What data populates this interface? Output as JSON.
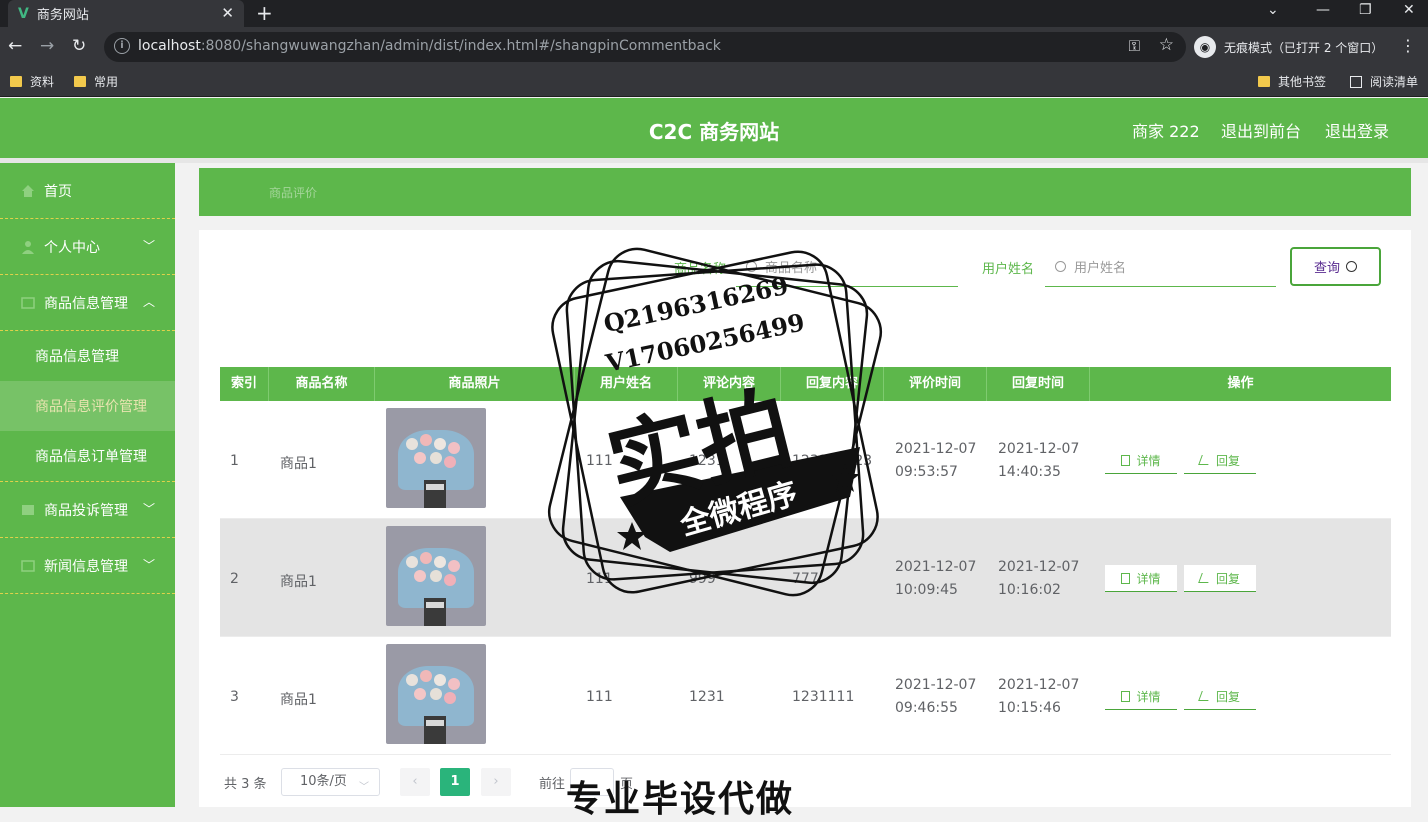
{
  "browser": {
    "tab_title": "商务网站",
    "url_host": "localhost",
    "url_rest": ":8080/shangwuwangzhan/admin/dist/index.html#/shangpinCommentback",
    "incognito_label": "无痕模式（已打开 2 个窗口）",
    "bookmarks": [
      "资料",
      "常用"
    ],
    "bookmarks_right": [
      "其他书签",
      "阅读清单"
    ]
  },
  "header": {
    "title": "C2C 商务网站",
    "user": "商家 222",
    "to_front": "退出到前台",
    "logout": "退出登录"
  },
  "sidebar": {
    "items": [
      {
        "label": "首页",
        "icon": "home-icon"
      },
      {
        "label": "个人中心",
        "icon": "user-icon",
        "chevron": "down"
      },
      {
        "label": "商品信息管理",
        "icon": "box-icon",
        "chevron": "up"
      },
      {
        "label": "商品投诉管理",
        "icon": "box-icon",
        "chevron": "down"
      },
      {
        "label": "新闻信息管理",
        "icon": "box-icon",
        "chevron": "down"
      }
    ],
    "sub_items": [
      "商品信息管理",
      "商品信息评价管理",
      "商品信息订单管理"
    ],
    "active_sub": 1
  },
  "breadcrumb": "商品评价",
  "search": {
    "product_label": "商品名称",
    "product_placeholder": "商品名称",
    "user_label": "用户姓名",
    "user_placeholder": "用户姓名",
    "query_button": "查询"
  },
  "table": {
    "headers": [
      "索引",
      "商品名称",
      "商品照片",
      "用户姓名",
      "评论内容",
      "回复内容",
      "评价时间",
      "回复时间",
      "操作"
    ],
    "rows": [
      {
        "index": "1",
        "name": "商品1",
        "user": "111",
        "comment": "1231",
        "reply": "123123123",
        "time1_date": "2021-12-07",
        "time1_clock": "09:53:57",
        "time2_date": "2021-12-07",
        "time2_clock": "14:40:35"
      },
      {
        "index": "2",
        "name": "商品1",
        "user": "111",
        "comment": "999",
        "reply": "777",
        "time1_date": "2021-12-07",
        "time1_clock": "10:09:45",
        "time2_date": "2021-12-07",
        "time2_clock": "10:16:02"
      },
      {
        "index": "3",
        "name": "商品1",
        "user": "111",
        "comment": "1231",
        "reply": "1231111",
        "time1_date": "2021-12-07",
        "time1_clock": "09:46:55",
        "time2_date": "2021-12-07",
        "time2_clock": "10:15:46"
      }
    ],
    "detail_button": "详情",
    "reply_button": "回复"
  },
  "pagination": {
    "total": "共 3 条",
    "page_size": "10条/页",
    "current_page": "1",
    "goto_prefix": "前往",
    "goto_suffix": "页"
  },
  "watermark": {
    "qq": "Q2196316269",
    "wechat": "V17060256499",
    "main": "实拍",
    "banner": "全微程序",
    "bottom": "专业毕设代做"
  },
  "colors": {
    "brand_green": "#5db74b",
    "pager_active": "#2ab47b",
    "query_text": "#5a2d91"
  }
}
